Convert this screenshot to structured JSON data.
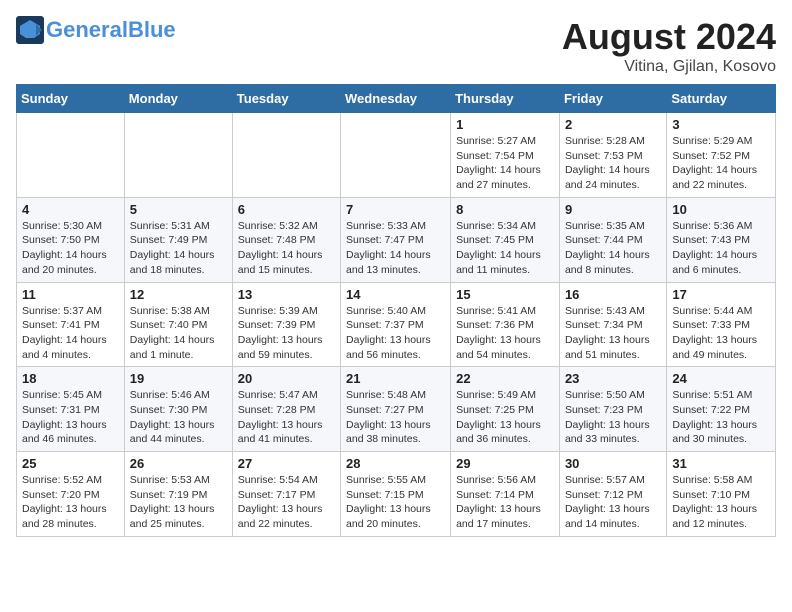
{
  "header": {
    "logo_general": "General",
    "logo_blue": "Blue",
    "month_year": "August 2024",
    "location": "Vitina, Gjilan, Kosovo"
  },
  "weekdays": [
    "Sunday",
    "Monday",
    "Tuesday",
    "Wednesday",
    "Thursday",
    "Friday",
    "Saturday"
  ],
  "weeks": [
    [
      {
        "day": "",
        "info": ""
      },
      {
        "day": "",
        "info": ""
      },
      {
        "day": "",
        "info": ""
      },
      {
        "day": "",
        "info": ""
      },
      {
        "day": "1",
        "info": "Sunrise: 5:27 AM\nSunset: 7:54 PM\nDaylight: 14 hours and 27 minutes."
      },
      {
        "day": "2",
        "info": "Sunrise: 5:28 AM\nSunset: 7:53 PM\nDaylight: 14 hours and 24 minutes."
      },
      {
        "day": "3",
        "info": "Sunrise: 5:29 AM\nSunset: 7:52 PM\nDaylight: 14 hours and 22 minutes."
      }
    ],
    [
      {
        "day": "4",
        "info": "Sunrise: 5:30 AM\nSunset: 7:50 PM\nDaylight: 14 hours and 20 minutes."
      },
      {
        "day": "5",
        "info": "Sunrise: 5:31 AM\nSunset: 7:49 PM\nDaylight: 14 hours and 18 minutes."
      },
      {
        "day": "6",
        "info": "Sunrise: 5:32 AM\nSunset: 7:48 PM\nDaylight: 14 hours and 15 minutes."
      },
      {
        "day": "7",
        "info": "Sunrise: 5:33 AM\nSunset: 7:47 PM\nDaylight: 14 hours and 13 minutes."
      },
      {
        "day": "8",
        "info": "Sunrise: 5:34 AM\nSunset: 7:45 PM\nDaylight: 14 hours and 11 minutes."
      },
      {
        "day": "9",
        "info": "Sunrise: 5:35 AM\nSunset: 7:44 PM\nDaylight: 14 hours and 8 minutes."
      },
      {
        "day": "10",
        "info": "Sunrise: 5:36 AM\nSunset: 7:43 PM\nDaylight: 14 hours and 6 minutes."
      }
    ],
    [
      {
        "day": "11",
        "info": "Sunrise: 5:37 AM\nSunset: 7:41 PM\nDaylight: 14 hours and 4 minutes."
      },
      {
        "day": "12",
        "info": "Sunrise: 5:38 AM\nSunset: 7:40 PM\nDaylight: 14 hours and 1 minute."
      },
      {
        "day": "13",
        "info": "Sunrise: 5:39 AM\nSunset: 7:39 PM\nDaylight: 13 hours and 59 minutes."
      },
      {
        "day": "14",
        "info": "Sunrise: 5:40 AM\nSunset: 7:37 PM\nDaylight: 13 hours and 56 minutes."
      },
      {
        "day": "15",
        "info": "Sunrise: 5:41 AM\nSunset: 7:36 PM\nDaylight: 13 hours and 54 minutes."
      },
      {
        "day": "16",
        "info": "Sunrise: 5:43 AM\nSunset: 7:34 PM\nDaylight: 13 hours and 51 minutes."
      },
      {
        "day": "17",
        "info": "Sunrise: 5:44 AM\nSunset: 7:33 PM\nDaylight: 13 hours and 49 minutes."
      }
    ],
    [
      {
        "day": "18",
        "info": "Sunrise: 5:45 AM\nSunset: 7:31 PM\nDaylight: 13 hours and 46 minutes."
      },
      {
        "day": "19",
        "info": "Sunrise: 5:46 AM\nSunset: 7:30 PM\nDaylight: 13 hours and 44 minutes."
      },
      {
        "day": "20",
        "info": "Sunrise: 5:47 AM\nSunset: 7:28 PM\nDaylight: 13 hours and 41 minutes."
      },
      {
        "day": "21",
        "info": "Sunrise: 5:48 AM\nSunset: 7:27 PM\nDaylight: 13 hours and 38 minutes."
      },
      {
        "day": "22",
        "info": "Sunrise: 5:49 AM\nSunset: 7:25 PM\nDaylight: 13 hours and 36 minutes."
      },
      {
        "day": "23",
        "info": "Sunrise: 5:50 AM\nSunset: 7:23 PM\nDaylight: 13 hours and 33 minutes."
      },
      {
        "day": "24",
        "info": "Sunrise: 5:51 AM\nSunset: 7:22 PM\nDaylight: 13 hours and 30 minutes."
      }
    ],
    [
      {
        "day": "25",
        "info": "Sunrise: 5:52 AM\nSunset: 7:20 PM\nDaylight: 13 hours and 28 minutes."
      },
      {
        "day": "26",
        "info": "Sunrise: 5:53 AM\nSunset: 7:19 PM\nDaylight: 13 hours and 25 minutes."
      },
      {
        "day": "27",
        "info": "Sunrise: 5:54 AM\nSunset: 7:17 PM\nDaylight: 13 hours and 22 minutes."
      },
      {
        "day": "28",
        "info": "Sunrise: 5:55 AM\nSunset: 7:15 PM\nDaylight: 13 hours and 20 minutes."
      },
      {
        "day": "29",
        "info": "Sunrise: 5:56 AM\nSunset: 7:14 PM\nDaylight: 13 hours and 17 minutes."
      },
      {
        "day": "30",
        "info": "Sunrise: 5:57 AM\nSunset: 7:12 PM\nDaylight: 13 hours and 14 minutes."
      },
      {
        "day": "31",
        "info": "Sunrise: 5:58 AM\nSunset: 7:10 PM\nDaylight: 13 hours and 12 minutes."
      }
    ]
  ]
}
